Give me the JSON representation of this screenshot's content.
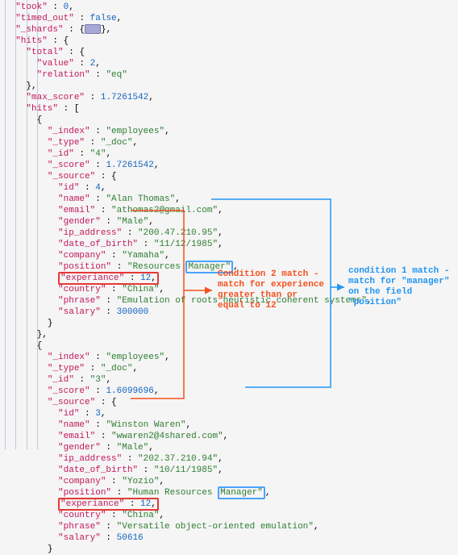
{
  "cover": {
    "took": {
      "key": "\"took\"",
      "val": "0"
    },
    "timed": {
      "key": "\"timed_out\"",
      "val": "false"
    },
    "shards": {
      "key": "\"_shards\""
    },
    "hits": {
      "key": "\"hits\""
    },
    "total": {
      "key": "\"total\""
    },
    "value": {
      "key": "\"value\"",
      "val": "2"
    },
    "relation": {
      "key": "\"relation\"",
      "val": "\"eq\""
    },
    "max_score": {
      "key": "\"max_score\"",
      "val": "1.7261542"
    },
    "hits_arr": {
      "key": "\"hits\""
    }
  },
  "common": {
    "index": {
      "key": "\"_index\"",
      "val": "\"employees\""
    },
    "type": {
      "key": "\"_type\"",
      "val": "\"_doc\""
    },
    "idk": "\"_id\"",
    "scorek": "\"_score\"",
    "source": {
      "key": "\"_source\""
    },
    "fields": {
      "id": "\"id\"",
      "name": "\"name\"",
      "email": "\"email\"",
      "gender": "\"gender\"",
      "ip": "\"ip_address\"",
      "dob": "\"date_of_birth\"",
      "company": "\"company\"",
      "position": "\"position\"",
      "exp": "\"experiance\"",
      "country": "\"country\"",
      "phrase": "\"phrase\"",
      "salary": "\"salary\""
    }
  },
  "h1": {
    "_id": "\"4\"",
    "_score": "1.7261542",
    "id": "4",
    "name": "\"Alan Thomas\"",
    "email": "\"athomas2@gmail.com\"",
    "gender": "\"Male\"",
    "ip": "\"200.47.210.95\"",
    "dob": "\"11/12/1985\"",
    "company": "\"Yamaha\"",
    "pos_pre": "\"Resources ",
    "pos_hi": "Manager\"",
    "exp_key": "\"experiance\"",
    "exp_val": "12",
    "country": "\"China\"",
    "phrase": "\"Emulation of roots heuristic coherent systems\"",
    "salary": "300000"
  },
  "h2": {
    "_id": "\"3\"",
    "_score": "1.6099696",
    "id": "3",
    "name": "\"Winston Waren\"",
    "email": "\"wwaren2@4shared.com\"",
    "gender": "\"Male\"",
    "ip": "\"202.37.210.94\"",
    "dob": "\"10/11/1985\"",
    "company": "\"Yozio\"",
    "pos_pre": "\"Human Resources ",
    "pos_hi": "Manager\"",
    "exp_key": "\"experiance\"",
    "exp_val": "12",
    "country": "\"China\"",
    "phrase": "\"Versatile object-oriented emulation\"",
    "salary": "50616"
  },
  "annot": {
    "red": "Condition 2 match - match for experience greater than or equal to 12",
    "blue": "condition 1 match - match for \"manager\" on the field \"position\""
  }
}
